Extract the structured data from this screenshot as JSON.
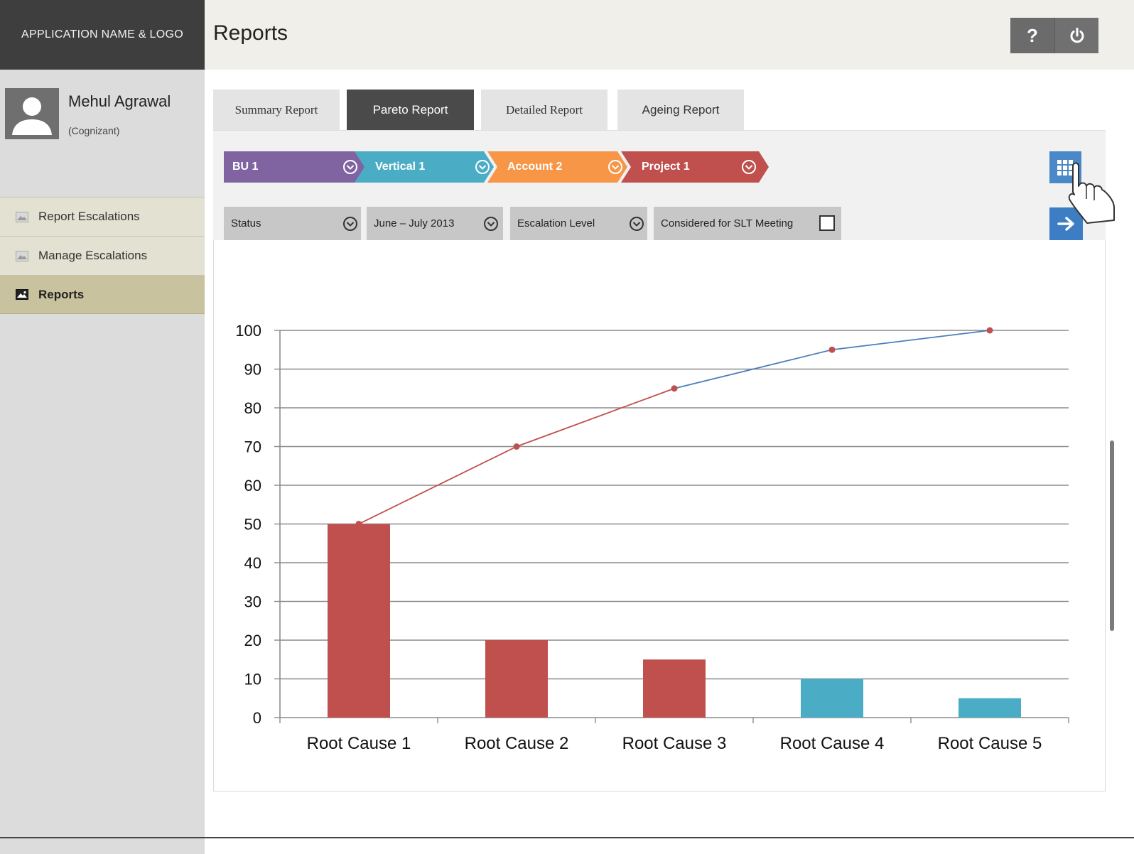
{
  "app": {
    "logo_text": "APPLICATION NAME & LOGO"
  },
  "user": {
    "name": "Mehul Agrawal",
    "organization": "(Cognizant)"
  },
  "nav": {
    "items": [
      {
        "label": "Report Escalations",
        "active": false
      },
      {
        "label": "Manage Escalations",
        "active": false
      },
      {
        "label": "Reports",
        "active": true
      }
    ]
  },
  "header": {
    "title": "Reports",
    "help_label": "?",
    "power_icon": "power-icon"
  },
  "tabs": [
    {
      "label": "Summary Report",
      "active": false
    },
    {
      "label": "Pareto Report",
      "active": true
    },
    {
      "label": "Detailed Report",
      "active": false
    },
    {
      "label": "Ageing Report",
      "active": false
    }
  ],
  "breadcrumb": [
    {
      "label": "BU 1",
      "color": "#8064a2"
    },
    {
      "label": "Vertical 1",
      "color": "#4bacc6"
    },
    {
      "label": "Account 2",
      "color": "#f79646"
    },
    {
      "label": "Project 1",
      "color": "#c0504d"
    }
  ],
  "filters": {
    "status": "Status",
    "period": "June – July 2013",
    "escalation_level": "Escalation Level",
    "slt_label": "Considered for SLT Meeting",
    "slt_checked": false
  },
  "chart_data": {
    "type": "bar",
    "categories": [
      "Root Cause 1",
      "Root Cause 2",
      "Root Cause 3",
      "Root Cause 4",
      "Root Cause 5"
    ],
    "series": [
      {
        "values": [
          50,
          20,
          15,
          10,
          5
        ],
        "colors": [
          "#c0504d",
          "#c0504d",
          "#c0504d",
          "#4bacc6",
          "#4bacc6"
        ]
      },
      {
        "type": "line",
        "values": [
          50,
          70,
          85,
          95,
          100
        ],
        "colors": [
          "#c0504d",
          "#c0504d",
          "#c0504d",
          "#4a7ebb",
          "#4a7ebb"
        ]
      }
    ],
    "yticks": [
      0,
      10,
      20,
      30,
      40,
      50,
      60,
      70,
      80,
      90,
      100
    ],
    "ylim": [
      0,
      100
    ],
    "grid": true
  }
}
